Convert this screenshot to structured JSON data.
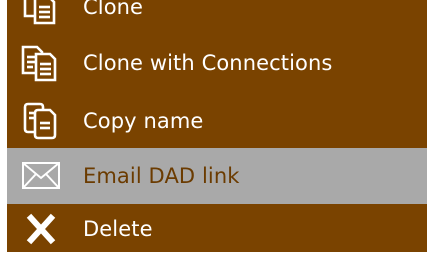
{
  "context_menu": {
    "background_color": "#7a4300",
    "highlight_color": "#a9a9a9",
    "items": [
      {
        "label": "Clone",
        "icon": "clone-icon",
        "state": "normal"
      },
      {
        "label": "Clone with Connections",
        "icon": "clone-with-connections-icon",
        "state": "normal"
      },
      {
        "label": "Copy name",
        "icon": "copy-name-icon",
        "state": "normal"
      },
      {
        "label": "Email DAD link",
        "icon": "envelope-icon",
        "state": "disabled-highlighted"
      },
      {
        "label": "Delete",
        "icon": "delete-x-icon",
        "state": "normal"
      }
    ]
  }
}
